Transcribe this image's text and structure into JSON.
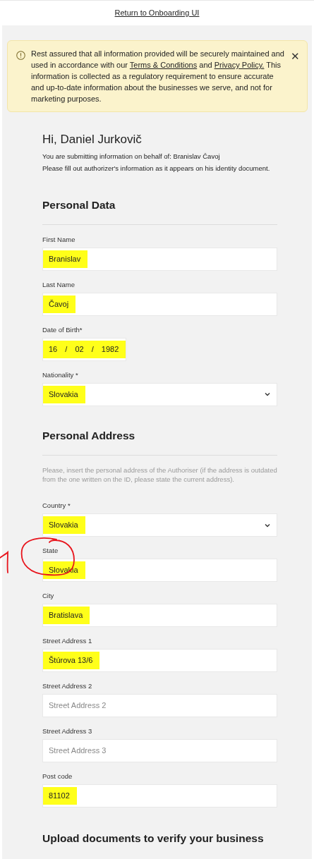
{
  "top_link": "Return to Onboarding UI",
  "alert": {
    "text_before": "Rest assured that all information provided will be securely maintained and used in accordance with our",
    "terms_link": "Terms & Conditions",
    "middle": "and",
    "privacy_link": "Privacy Policy.",
    "text_after": "This information is collected as a regulatory requirement to ensure accurate and up-to-date information about the businesses we serve, and not for marketing purposes.",
    "close": "✕"
  },
  "greeting": {
    "title": "Hi, Daniel Jurkovič",
    "line_1": "You are submitting information on behalf of: Branislav Čavoj",
    "line_2": "Please fill out authorizer's information as it appears on his identity document."
  },
  "sections": [
    {
      "title": "Personal Data",
      "fields": [
        {
          "kind": "text",
          "label": "First Name",
          "value": "Branislav",
          "highlighted": true
        },
        {
          "kind": "text",
          "label": "Last Name",
          "value": "Čavoj",
          "highlighted": true
        },
        {
          "kind": "date",
          "label": "Date of Birth*",
          "value": "16 / 02 / 1982",
          "highlighted": true
        },
        {
          "kind": "select",
          "label": "Nationality *",
          "value": "Slovakia",
          "highlighted": true
        }
      ]
    },
    {
      "title": "Personal Address",
      "note": "Please, insert the personal address of the Authoriser (if the address is outdated from the one written on the ID, please state the current address).",
      "fields": [
        {
          "kind": "select",
          "label": "Country *",
          "value": "Slovakia",
          "highlighted": true
        },
        {
          "kind": "text",
          "label": "State",
          "value": "Slovakia",
          "highlighted": true,
          "circled": true
        },
        {
          "kind": "text",
          "label": "City",
          "value": "Bratislava",
          "highlighted": true
        },
        {
          "kind": "text",
          "label": "Street Address 1",
          "value": "Štúrova 13/6",
          "highlighted": true
        },
        {
          "kind": "text",
          "label": "Street Address 2",
          "placeholder": "Street Address 2"
        },
        {
          "kind": "text",
          "label": "Street Address 3",
          "placeholder": "Street Address 3"
        },
        {
          "kind": "text",
          "label": "Post code",
          "value": "81102",
          "highlighted": true
        }
      ]
    }
  ],
  "upload_title": "Upload documents to verify your business"
}
